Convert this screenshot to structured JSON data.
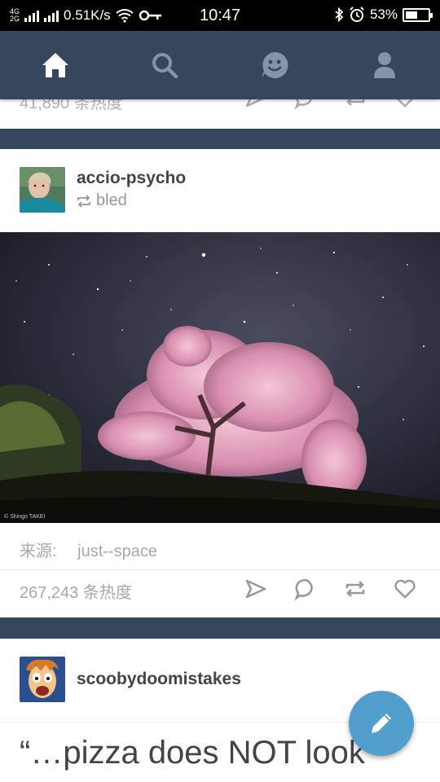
{
  "status_bar": {
    "network_top": "4G",
    "network_bottom": "2G",
    "speed": "0.51K/s",
    "time": "10:47",
    "battery_percent_label": "53%",
    "battery_level": 0.53
  },
  "nav": {
    "items": [
      {
        "icon": "home-icon",
        "active": true
      },
      {
        "icon": "search-icon",
        "active": false
      },
      {
        "icon": "smiley-icon",
        "active": false
      },
      {
        "icon": "account-icon",
        "active": false
      }
    ]
  },
  "prev_post": {
    "notes": "41,890 条热度"
  },
  "post": {
    "blog_name": "accio-psycho",
    "reblogged_from": "bled",
    "photo_credit": "© Shingo TAKEI",
    "source_label": "来源:",
    "source_blog": "just--space",
    "notes": "267,243 条热度"
  },
  "next_post": {
    "blog_name": "scoobydoomistakes",
    "quote": "“…pizza does NOT look"
  },
  "colors": {
    "navy": "#36465d",
    "accent": "#529ecc"
  }
}
